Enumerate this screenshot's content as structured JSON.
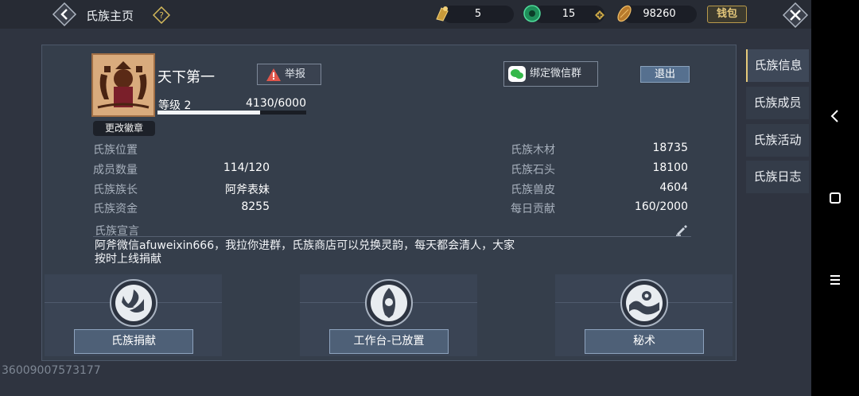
{
  "header": {
    "title": "氏族主页",
    "resources": [
      {
        "icon": "bell-icon",
        "value": "5"
      },
      {
        "icon": "jade-icon",
        "value": "15"
      },
      {
        "icon": "ingot-icon",
        "value": "98260"
      }
    ],
    "wallet_label": "钱包"
  },
  "clan": {
    "name": "天下第一",
    "report_label": "举报",
    "wechat_label": "绑定微信群",
    "quit_label": "退出",
    "level_label": "等级 2",
    "exp_text": "4130/6000",
    "exp_fraction": 0.688,
    "change_emblem_label": "更改徽章"
  },
  "stats_left": [
    {
      "label": "氏族位置",
      "value": ""
    },
    {
      "label": "成员数量",
      "value": "114/120"
    },
    {
      "label": "氏族族长",
      "value": "阿斧表妹"
    },
    {
      "label": "氏族资金",
      "value": "8255"
    }
  ],
  "stats_right": [
    {
      "label": "氏族木材",
      "value": "18735"
    },
    {
      "label": "氏族石头",
      "value": "18100"
    },
    {
      "label": "氏族兽皮",
      "value": "4604"
    },
    {
      "label": "每日贡献",
      "value": "160/2000"
    }
  ],
  "declaration": {
    "label": "氏族宣言",
    "line1": "阿斧微信afuweixin666，我拉你进群，氏族商店可以兑换灵韵，每天都会清人，大家",
    "line2": "按时上线捐献"
  },
  "features": [
    {
      "label": "氏族捐献"
    },
    {
      "label": "工作台-已放置"
    },
    {
      "label": "秘术"
    }
  ],
  "side_tabs": [
    {
      "label": "氏族信息",
      "active": true
    },
    {
      "label": "氏族成员",
      "active": false
    },
    {
      "label": "氏族活动",
      "active": false
    },
    {
      "label": "氏族日志",
      "active": false
    }
  ],
  "footer_id": "36009007573177",
  "colors": {
    "accent_gold": "#e5c97a",
    "button_blue": "#4e6077",
    "panel_bg": "#353e4b"
  }
}
